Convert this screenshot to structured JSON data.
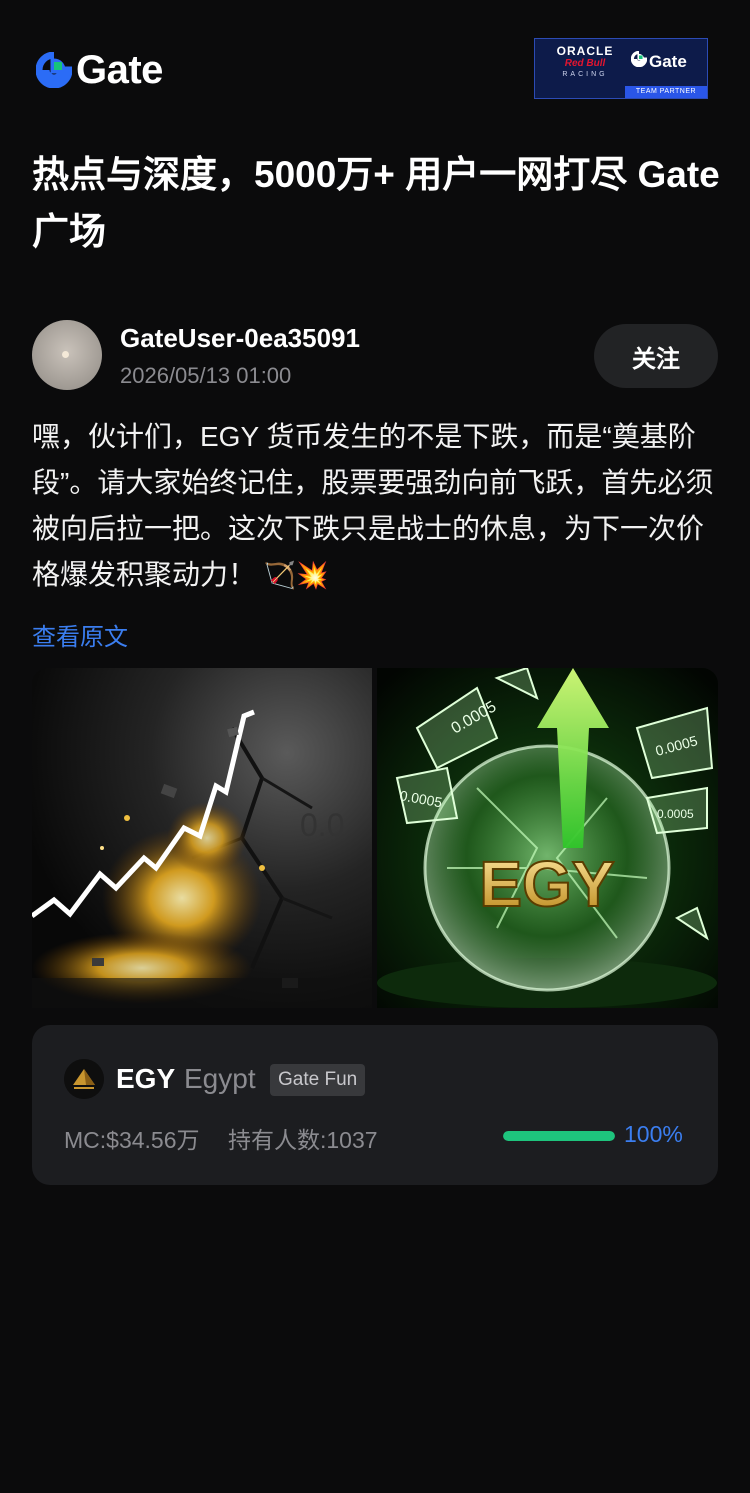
{
  "header": {
    "brand": "Gate",
    "partner": {
      "oracle": "ORACLE",
      "redbull": "Red Bull",
      "racing": "RACING",
      "gate": "Gate",
      "badge": "TEAM PARTNER"
    }
  },
  "headline": "热点与深度，5000万+ 用户一网打尽 Gate 广场",
  "post": {
    "author": "GateUser-0ea35091",
    "time": "2026/05/13 01:00",
    "follow_label": "关注",
    "text": "嘿，伙计们，EGY 货币发生的不是下跌，而是“奠基阶段”。请大家始终记住，股票要强劲向前飞跃，首先必须被向后拉一把。这次下跌只是战士的休息，为下一次价格爆发积聚动力！",
    "emoji": "🏹💥",
    "view_original": "查看原文"
  },
  "images": [
    {
      "label": "0.0"
    },
    {
      "label": "EGY",
      "shards": [
        "0.0005",
        "0.0005",
        "0.0005",
        "0.0005"
      ]
    }
  ],
  "token": {
    "symbol": "EGY",
    "name": "Egypt",
    "badge": "Gate Fun",
    "market_cap": "MC:$34.56万",
    "holders": "持有人数:1037",
    "progress": 100,
    "progress_label": "100%",
    "progress_color": "#1ec47d",
    "accent": "#3b7ef0"
  }
}
